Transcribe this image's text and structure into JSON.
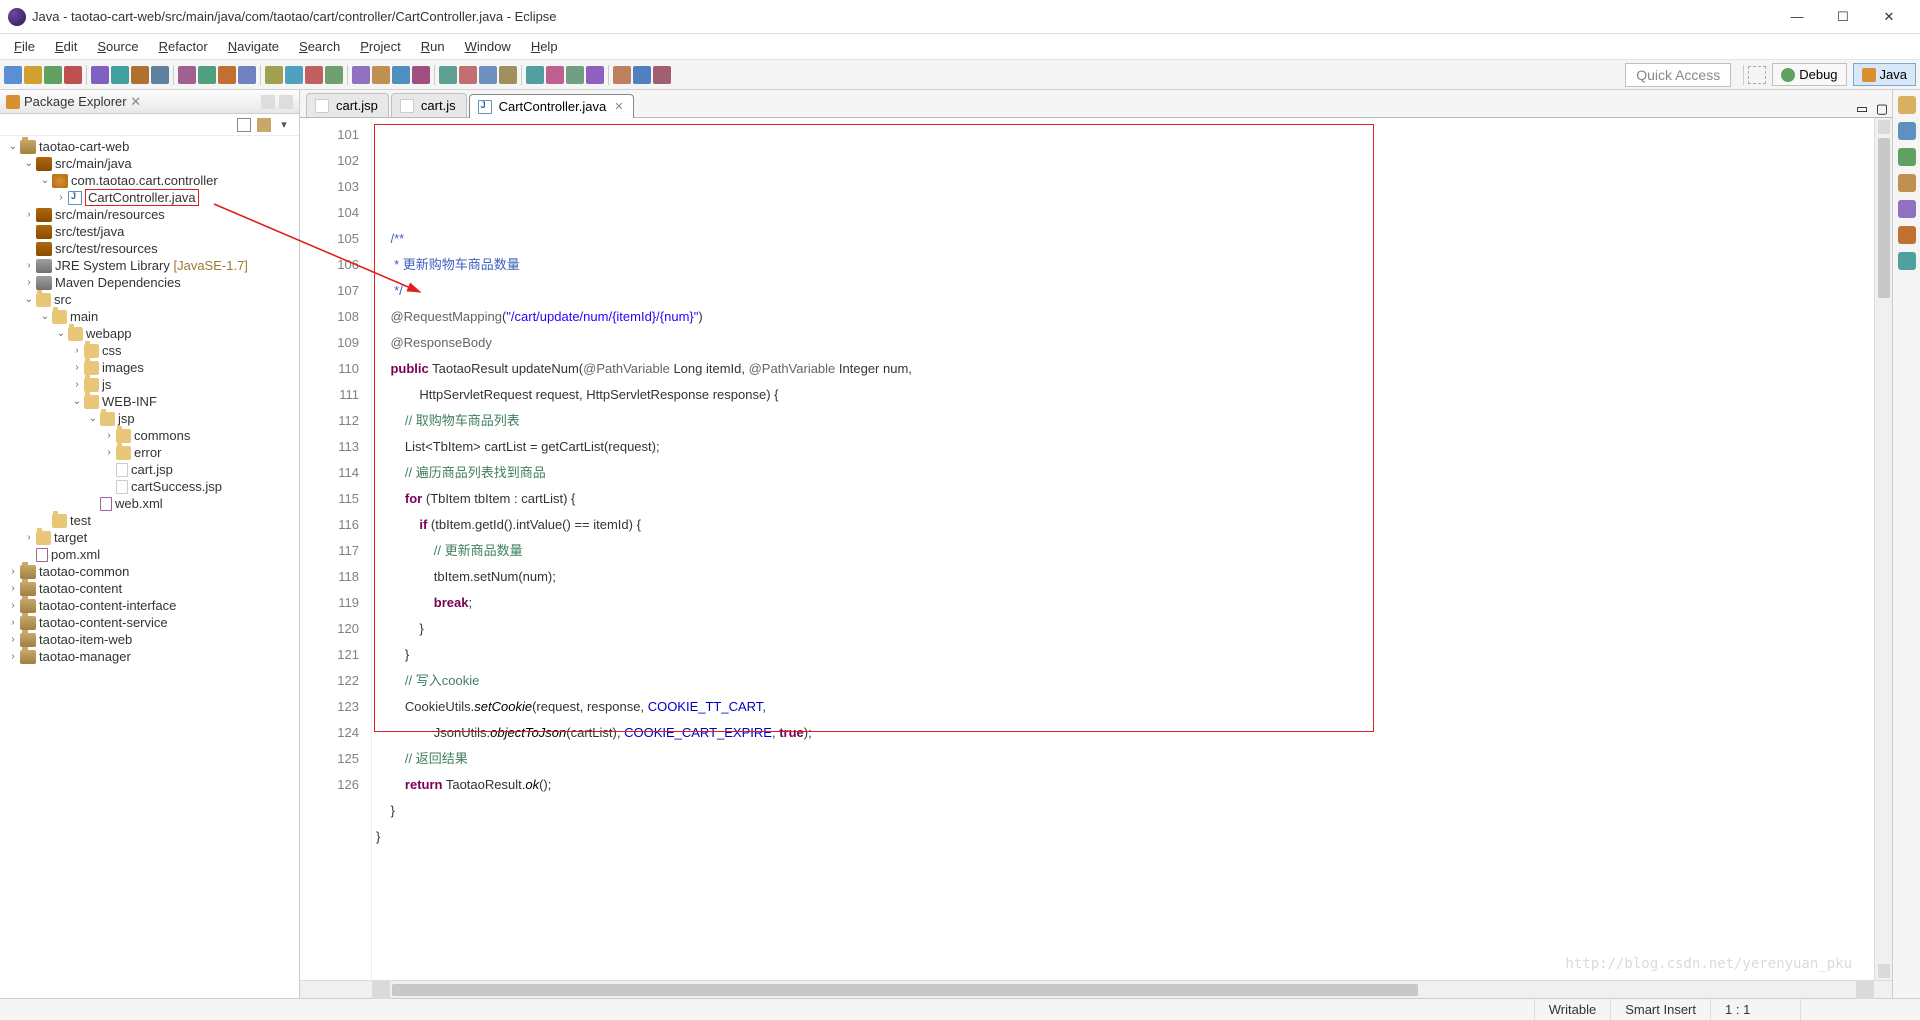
{
  "titlebar": {
    "title": "Java - taotao-cart-web/src/main/java/com/taotao/cart/controller/CartController.java - Eclipse"
  },
  "menu": {
    "items": [
      "File",
      "Edit",
      "Source",
      "Refactor",
      "Navigate",
      "Search",
      "Project",
      "Run",
      "Window",
      "Help"
    ]
  },
  "toolbar": {
    "quick_access": "Quick Access",
    "perspectives": {
      "debug": "Debug",
      "java": "Java"
    }
  },
  "package_explorer": {
    "title": "Package Explorer",
    "tree": [
      {
        "indent": 0,
        "tw": "v",
        "icon": "proj",
        "label": "taotao-cart-web"
      },
      {
        "indent": 1,
        "tw": "v",
        "icon": "pkgroot",
        "label": "src/main/java"
      },
      {
        "indent": 2,
        "tw": "v",
        "icon": "pkg",
        "label": "com.taotao.cart.controller"
      },
      {
        "indent": 3,
        "tw": ">",
        "icon": "java",
        "label": "CartController.java",
        "highlight": true
      },
      {
        "indent": 1,
        "tw": ">",
        "icon": "pkgroot",
        "label": "src/main/resources"
      },
      {
        "indent": 1,
        "tw": "",
        "icon": "pkgroot",
        "label": "src/test/java"
      },
      {
        "indent": 1,
        "tw": "",
        "icon": "pkgroot",
        "label": "src/test/resources"
      },
      {
        "indent": 1,
        "tw": ">",
        "icon": "lib",
        "label": "JRE System Library",
        "deco": " [JavaSE-1.7]"
      },
      {
        "indent": 1,
        "tw": ">",
        "icon": "lib",
        "label": "Maven Dependencies"
      },
      {
        "indent": 1,
        "tw": "v",
        "icon": "folder",
        "label": "src"
      },
      {
        "indent": 2,
        "tw": "v",
        "icon": "folder",
        "label": "main"
      },
      {
        "indent": 3,
        "tw": "v",
        "icon": "folder",
        "label": "webapp"
      },
      {
        "indent": 4,
        "tw": ">",
        "icon": "folder",
        "label": "css"
      },
      {
        "indent": 4,
        "tw": ">",
        "icon": "folder",
        "label": "images"
      },
      {
        "indent": 4,
        "tw": ">",
        "icon": "folder",
        "label": "js"
      },
      {
        "indent": 4,
        "tw": "v",
        "icon": "folder",
        "label": "WEB-INF"
      },
      {
        "indent": 5,
        "tw": "v",
        "icon": "folder",
        "label": "jsp"
      },
      {
        "indent": 6,
        "tw": ">",
        "icon": "folder",
        "label": "commons"
      },
      {
        "indent": 6,
        "tw": ">",
        "icon": "folder",
        "label": "error"
      },
      {
        "indent": 6,
        "tw": "",
        "icon": "file",
        "label": "cart.jsp"
      },
      {
        "indent": 6,
        "tw": "",
        "icon": "file",
        "label": "cartSuccess.jsp"
      },
      {
        "indent": 5,
        "tw": "",
        "icon": "xml",
        "label": "web.xml"
      },
      {
        "indent": 2,
        "tw": "",
        "icon": "folder",
        "label": "test"
      },
      {
        "indent": 1,
        "tw": ">",
        "icon": "folder",
        "label": "target"
      },
      {
        "indent": 1,
        "tw": "",
        "icon": "xml",
        "label": "pom.xml"
      },
      {
        "indent": 0,
        "tw": ">",
        "icon": "proj",
        "label": "taotao-common"
      },
      {
        "indent": 0,
        "tw": ">",
        "icon": "proj",
        "label": "taotao-content"
      },
      {
        "indent": 0,
        "tw": ">",
        "icon": "proj",
        "label": "taotao-content-interface"
      },
      {
        "indent": 0,
        "tw": ">",
        "icon": "proj",
        "label": "taotao-content-service"
      },
      {
        "indent": 0,
        "tw": ">",
        "icon": "proj",
        "label": "taotao-item-web"
      },
      {
        "indent": 0,
        "tw": ">",
        "icon": "proj",
        "label": "taotao-manager"
      }
    ]
  },
  "editor": {
    "tabs": [
      {
        "label": "cart.jsp",
        "icon": "file",
        "active": false
      },
      {
        "label": "cart.js",
        "icon": "file",
        "active": false
      },
      {
        "label": "CartController.java",
        "icon": "java",
        "active": true
      }
    ],
    "first_line_no": 101,
    "lines": [
      {
        "n": 101,
        "seg": [
          {
            "t": "    ",
            "c": ""
          }
        ]
      },
      {
        "n": 102,
        "seg": [
          {
            "t": "    ",
            "c": ""
          },
          {
            "t": "/**",
            "c": "jd"
          }
        ]
      },
      {
        "n": 103,
        "seg": [
          {
            "t": "     ",
            "c": ""
          },
          {
            "t": "* 更新购物车商品数量",
            "c": "jd"
          }
        ]
      },
      {
        "n": 104,
        "seg": [
          {
            "t": "     ",
            "c": ""
          },
          {
            "t": "*/",
            "c": "jd"
          }
        ]
      },
      {
        "n": 105,
        "seg": [
          {
            "t": "    ",
            "c": ""
          },
          {
            "t": "@RequestMapping",
            "c": "ann"
          },
          {
            "t": "(",
            "c": ""
          },
          {
            "t": "\"/cart/update/num/{itemId}/{num}\"",
            "c": "str"
          },
          {
            "t": ")",
            "c": ""
          }
        ]
      },
      {
        "n": 106,
        "seg": [
          {
            "t": "    ",
            "c": ""
          },
          {
            "t": "@ResponseBody",
            "c": "ann"
          }
        ]
      },
      {
        "n": 107,
        "seg": [
          {
            "t": "    ",
            "c": ""
          },
          {
            "t": "public",
            "c": "kw"
          },
          {
            "t": " TaotaoResult updateNum(",
            "c": ""
          },
          {
            "t": "@PathVariable",
            "c": "ann"
          },
          {
            "t": " Long itemId, ",
            "c": ""
          },
          {
            "t": "@PathVariable",
            "c": "ann"
          },
          {
            "t": " Integer num,",
            "c": ""
          }
        ]
      },
      {
        "n": 108,
        "seg": [
          {
            "t": "            HttpServletRequest request, HttpServletResponse response) {",
            "c": ""
          }
        ]
      },
      {
        "n": 109,
        "seg": [
          {
            "t": "        ",
            "c": ""
          },
          {
            "t": "// 取购物车商品列表",
            "c": "cmt"
          }
        ]
      },
      {
        "n": 110,
        "seg": [
          {
            "t": "        List<TbItem> cartList = getCartList(request);",
            "c": ""
          }
        ]
      },
      {
        "n": 111,
        "seg": [
          {
            "t": "        ",
            "c": ""
          },
          {
            "t": "// 遍历商品列表找到商品",
            "c": "cmt"
          }
        ]
      },
      {
        "n": 112,
        "seg": [
          {
            "t": "        ",
            "c": ""
          },
          {
            "t": "for",
            "c": "kw"
          },
          {
            "t": " (TbItem tbItem : cartList) {",
            "c": ""
          }
        ]
      },
      {
        "n": 113,
        "seg": [
          {
            "t": "            ",
            "c": ""
          },
          {
            "t": "if",
            "c": "kw"
          },
          {
            "t": " (tbItem.getId().intValue() == itemId) {",
            "c": ""
          }
        ]
      },
      {
        "n": 114,
        "seg": [
          {
            "t": "                ",
            "c": ""
          },
          {
            "t": "// 更新商品数量",
            "c": "cmt"
          }
        ]
      },
      {
        "n": 115,
        "seg": [
          {
            "t": "                tbItem.setNum(num);",
            "c": ""
          }
        ]
      },
      {
        "n": 116,
        "seg": [
          {
            "t": "                ",
            "c": ""
          },
          {
            "t": "break",
            "c": "kw"
          },
          {
            "t": ";",
            "c": ""
          }
        ]
      },
      {
        "n": 117,
        "seg": [
          {
            "t": "            }",
            "c": ""
          }
        ]
      },
      {
        "n": 118,
        "seg": [
          {
            "t": "        }",
            "c": ""
          }
        ]
      },
      {
        "n": 119,
        "seg": [
          {
            "t": "        ",
            "c": ""
          },
          {
            "t": "// 写入cookie",
            "c": "cmt"
          }
        ]
      },
      {
        "n": 120,
        "seg": [
          {
            "t": "        CookieUtils.",
            "c": ""
          },
          {
            "t": "setCookie",
            "c": "stm"
          },
          {
            "t": "(request, response, ",
            "c": ""
          },
          {
            "t": "COOKIE_TT_CART",
            "c": "fld"
          },
          {
            "t": ",",
            "c": ""
          }
        ]
      },
      {
        "n": 121,
        "seg": [
          {
            "t": "                JsonUtils.",
            "c": ""
          },
          {
            "t": "objectToJson",
            "c": "stm"
          },
          {
            "t": "(cartList), ",
            "c": ""
          },
          {
            "t": "COOKIE_CART_EXPIRE",
            "c": "fld"
          },
          {
            "t": ", ",
            "c": ""
          },
          {
            "t": "true",
            "c": "bool"
          },
          {
            "t": ");",
            "c": ""
          }
        ]
      },
      {
        "n": 122,
        "seg": [
          {
            "t": "        ",
            "c": ""
          },
          {
            "t": "// 返回结果",
            "c": "cmt"
          }
        ]
      },
      {
        "n": 123,
        "seg": [
          {
            "t": "        ",
            "c": ""
          },
          {
            "t": "return",
            "c": "kw"
          },
          {
            "t": " TaotaoResult.",
            "c": ""
          },
          {
            "t": "ok",
            "c": "stm"
          },
          {
            "t": "();",
            "c": ""
          }
        ]
      },
      {
        "n": 124,
        "seg": [
          {
            "t": "    }",
            "c": ""
          }
        ]
      },
      {
        "n": 125,
        "seg": [
          {
            "t": "",
            "c": ""
          }
        ]
      },
      {
        "n": 126,
        "seg": [
          {
            "t": "}",
            "c": ""
          }
        ]
      }
    ]
  },
  "statusbar": {
    "writable": "Writable",
    "insert": "Smart Insert",
    "pos": "1 : 1"
  },
  "watermark": "http://blog.csdn.net/yerenyuan_pku",
  "toolbar_icons": {
    "colors": [
      "#5a8fd6",
      "#d0a030",
      "#60a060",
      "#c05050",
      "#8060c0",
      "#40a0a0",
      "#b07030",
      "#6080a0",
      "#a06090",
      "#50a080",
      "#c07030",
      "#7080c0",
      "#a0a050",
      "#50a0c0",
      "#c06060",
      "#70a070",
      "#9070c0",
      "#c09050",
      "#5090c0",
      "#a05080",
      "#60a090",
      "#c07070",
      "#7090c0",
      "#a09060",
      "#50a0a0",
      "#c06090",
      "#70a080",
      "#9060c0",
      "#c08060",
      "#5080c0",
      "#a06070"
    ]
  },
  "strip_colors": [
    "#d8b060",
    "#6090c0",
    "#60a060",
    "#c09050",
    "#9070c0",
    "#c07030",
    "#50a0a0"
  ]
}
